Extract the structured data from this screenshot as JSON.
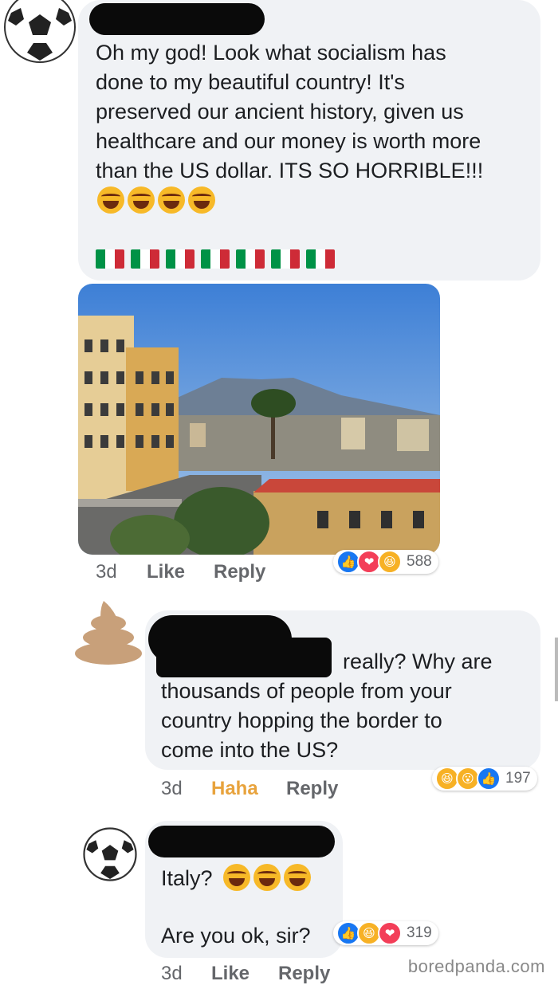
{
  "comments": [
    {
      "text": "Oh my god! Look what socialism has\ndone to my beautiful country! It's\npreserved our ancient history, given us\nhealthcare and our money is worth more\nthan the US dollar. ITS SO HORRIBLE!!!",
      "time": "3d",
      "like_label": "Like",
      "reply_label": "Reply",
      "reaction_count": "588",
      "reactions": [
        "like",
        "love",
        "haha"
      ]
    },
    {
      "text": "really? Why are\nthousands of people from your\ncountry hopping the border to\ncome into the US?",
      "time": "3d",
      "like_label": "Haha",
      "reply_label": "Reply",
      "reaction_count": "197",
      "reactions": [
        "haha",
        "wow",
        "like"
      ]
    },
    {
      "text_line1": "Italy?",
      "text_line2": "Are you ok, sir?",
      "time": "3d",
      "like_label": "Like",
      "reply_label": "Reply",
      "reaction_count": "319",
      "reactions": [
        "like",
        "haha",
        "love"
      ]
    }
  ],
  "watermark": "boredpanda.com",
  "colors": {
    "bubble": "#f0f2f5",
    "haha_action": "#e8a33d",
    "like_blue": "#1877f2",
    "love_red": "#f33e58"
  }
}
